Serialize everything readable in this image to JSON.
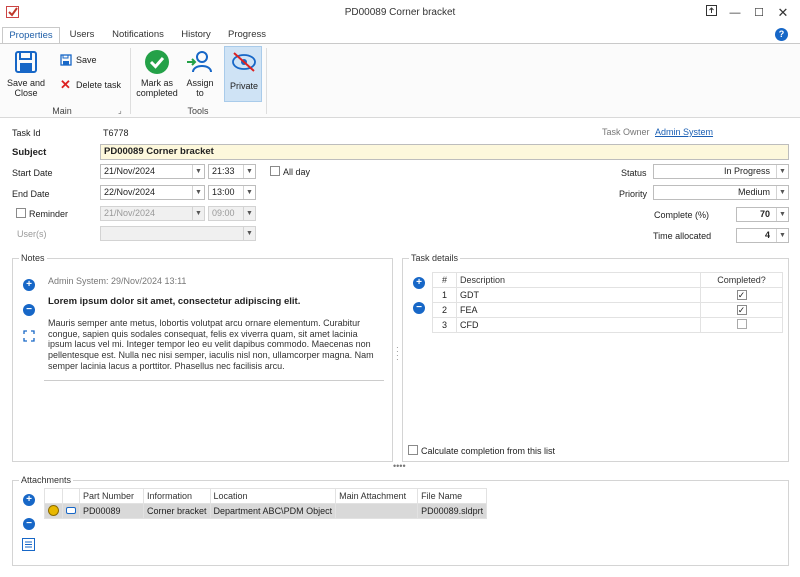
{
  "window": {
    "title": "PD00089 Corner bracket"
  },
  "tabs": [
    "Properties",
    "Users",
    "Notifications",
    "History",
    "Progress"
  ],
  "ribbon": {
    "save_close": "Save and Close",
    "save": "Save",
    "delete": "Delete task",
    "mark_completed": "Mark as completed",
    "assign": "Assign to",
    "private": "Private",
    "group_main": "Main",
    "group_tools": "Tools"
  },
  "form": {
    "task_id_label": "Task Id",
    "task_id": "T6778",
    "owner_label": "Task Owner",
    "owner": "Admin System",
    "subject_label": "Subject",
    "subject": "PD00089 Corner bracket",
    "start_label": "Start Date",
    "start_date": "21/Nov/2024",
    "start_time": "21:33",
    "allday_label": "All day",
    "end_label": "End Date",
    "end_date": "22/Nov/2024",
    "end_time": "13:00",
    "reminder_label": "Reminder",
    "reminder_date": "21/Nov/2024",
    "reminder_time": "09:00",
    "users_label": "User(s)",
    "status_label": "Status",
    "status": "In Progress",
    "priority_label": "Priority",
    "priority": "Medium",
    "complete_label": "Complete (%)",
    "complete": "70",
    "time_label": "Time allocated",
    "time": "4"
  },
  "notes": {
    "legend": "Notes",
    "header": "Admin System: 29/Nov/2024 13:11",
    "heading": "Lorem ipsum dolor sit amet, consectetur adipiscing elit.",
    "body": "Mauris semper ante metus, lobortis volutpat arcu ornare elementum. Curabitur congue, sapien quis sodales consequat, felis ex viverra quam, sit amet lacinia ipsum lacus vel mi. Integer tempor leo eu velit dapibus commodo. Maecenas non pellentesque est. Nulla nec nisi semper, iaculis nisl non, ullamcorper magna. Nam semper lacinia lacus a porttitor. Phasellus nec facilisis arcu."
  },
  "task_details": {
    "legend": "Task details",
    "col_num": "#",
    "col_desc": "Description",
    "col_done": "Completed?",
    "rows": [
      {
        "num": "1",
        "desc": "GDT",
        "done": "✓"
      },
      {
        "num": "2",
        "desc": "FEA",
        "done": "✓"
      },
      {
        "num": "3",
        "desc": "CFD",
        "done": ""
      }
    ],
    "calc_label": "Calculate completion from this list"
  },
  "attachments": {
    "legend": "Attachments",
    "cols": [
      "Part Number",
      "Information",
      "Location",
      "Main Attachment",
      "File Name"
    ],
    "row": {
      "part": "PD00089",
      "info": "Corner bracket",
      "location": "Department ABC\\PDM Object",
      "main": "",
      "file": "PD00089.sldprt"
    }
  }
}
